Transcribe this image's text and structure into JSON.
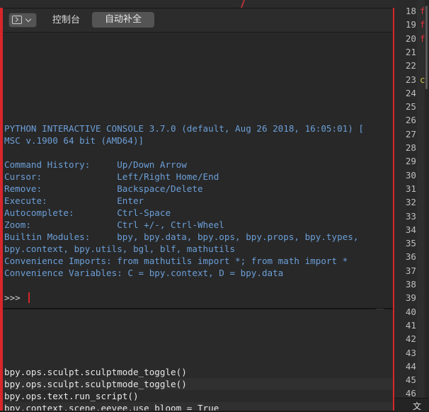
{
  "header": {
    "console_label": "控制台",
    "autocomplete_label": "自动补全"
  },
  "console": {
    "lines": [
      "PYTHON INTERACTIVE CONSOLE 3.7.0 (default, Aug 26 2018, 16:05:01) [",
      "MSC v.1900 64 bit (AMD64)]",
      "",
      "Command History:     Up/Down Arrow",
      "Cursor:              Left/Right Home/End",
      "Remove:              Backspace/Delete",
      "Execute:             Enter",
      "Autocomplete:        Ctrl-Space",
      "Zoom:                Ctrl +/-, Ctrl-Wheel",
      "Builtin Modules:     bpy, bpy.data, bpy.ops, bpy.props, bpy.types,",
      "bpy.context, bpy.utils, bgl, blf, mathutils",
      "Convenience Imports: from mathutils import *; from math import *",
      "Convenience Variables: C = bpy.context, D = bpy.data"
    ],
    "prompt": ">>> "
  },
  "info": {
    "lines": [
      "bpy.ops.sculpt.sculptmode_toggle()",
      "bpy.ops.sculpt.sculptmode_toggle()",
      "bpy.ops.text.run_script()",
      "bpy.context.scene.eevee.use_bloom = True"
    ]
  },
  "editor": {
    "line_numbers": [
      "18",
      "19",
      "20",
      "21",
      "22",
      "23",
      "24",
      "25",
      "26",
      "27",
      "28",
      "29",
      "30",
      "31",
      "32",
      "33",
      "34",
      "35",
      "36",
      "37",
      "38",
      "39",
      "40",
      "41",
      "42",
      "43",
      "44",
      "45",
      "46"
    ],
    "code_fragments": [
      {
        "line": "18",
        "text": "f",
        "color": "#e0323c"
      },
      {
        "line": "19",
        "text": "f",
        "color": "#e0323c"
      },
      {
        "line": "20",
        "text": "f",
        "color": "#e0323c"
      },
      {
        "line": "23",
        "text": "c",
        "color": "#c9c14b"
      }
    ],
    "footer_label": "文"
  },
  "colors": {
    "accent_red": "#d8262a",
    "console_text": "#6c9fd8"
  }
}
